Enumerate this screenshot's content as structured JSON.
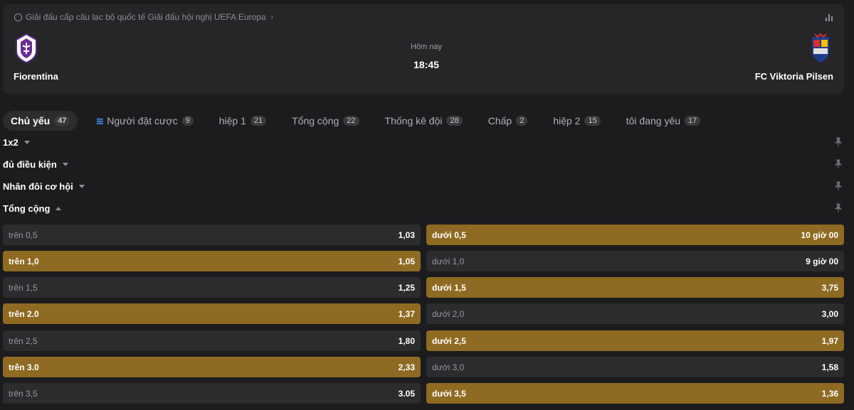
{
  "header": {
    "league": "Giải đấu cấp câu lạc bộ quốc tế Giải đấu hội nghị UEFA Europa",
    "league_chevron": "›",
    "home_team": "Fiorentina",
    "away_team": "FC Viktoria Pilsen",
    "date_label": "Hôm nay",
    "kickoff_time": "18:45",
    "icons": [
      "soccer-ball-icon",
      "stats-bars-icon"
    ]
  },
  "tabs": [
    {
      "label": "Chủ yếu",
      "count": "47",
      "active": true
    },
    {
      "label": "Người đặt cược",
      "count": "9",
      "icon": "bolt-icon"
    },
    {
      "label": "hiệp 1",
      "count": "21"
    },
    {
      "label": "Tổng cộng",
      "count": "22"
    },
    {
      "label": "Thống kê đội",
      "count": "28"
    },
    {
      "label": "Chấp",
      "count": "2"
    },
    {
      "label": "hiệp 2",
      "count": "15"
    },
    {
      "label": "tôi đang yêu",
      "count": "17"
    }
  ],
  "sections": [
    {
      "title": "1x2",
      "expanded": false
    },
    {
      "title": "đủ điều kiện",
      "expanded": false
    },
    {
      "title": "Nhân đôi cơ hội",
      "expanded": false
    },
    {
      "title": "Tổng cộng",
      "expanded": true
    }
  ],
  "totals": [
    {
      "over_label": "trên 0,5",
      "over_odds": "1,03",
      "under_label": "dưới 0,5",
      "under_odds": "10 giờ 00"
    },
    {
      "over_label": "trên 1,0",
      "over_odds": "1,05",
      "under_label": "dưới 1,0",
      "under_odds": "9 giờ 00"
    },
    {
      "over_label": "trên 1,5",
      "over_odds": "1,25",
      "under_label": "dưới 1,5",
      "under_odds": "3,75"
    },
    {
      "over_label": "trên 2.0",
      "over_odds": "1,37",
      "under_label": "dưới 2,0",
      "under_odds": "3,00"
    },
    {
      "over_label": "trên 2,5",
      "over_odds": "1,80",
      "under_label": "dưới 2,5",
      "under_odds": "1,97"
    },
    {
      "over_label": "trên 3.0",
      "over_odds": "2,33",
      "under_label": "dưới 3,0",
      "under_odds": "1,58"
    },
    {
      "over_label": "trên 3,5",
      "over_odds": "3.05",
      "under_label": "dưới 3,5",
      "under_odds": "1,36"
    }
  ],
  "colors": {
    "highlight": "#8f6a22",
    "plain": "#2c2c2e",
    "background": "#1c1c1e",
    "panel": "#262628"
  }
}
